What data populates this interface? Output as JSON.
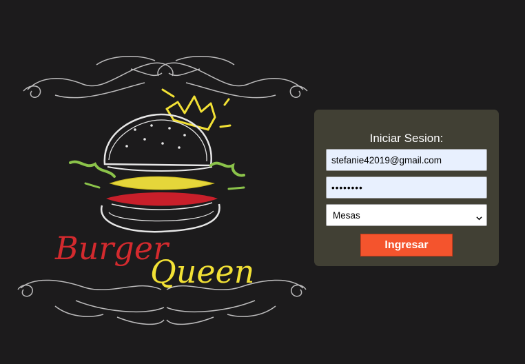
{
  "brand": {
    "word1": "Burger",
    "word2": "Queen"
  },
  "login": {
    "title": "Iniciar Sesion:",
    "email_value": "stefanie42019@gmail.com",
    "password_value": "••••••••",
    "role_selected": "Mesas",
    "submit_label": "Ingresar"
  },
  "colors": {
    "background": "#1c1b1c",
    "panel": "#414034",
    "button": "#f4542d",
    "brand_red": "#d32a2e",
    "brand_yellow": "#f2e135"
  },
  "icons": {
    "crown": "crown-icon",
    "burger": "burger-icon",
    "select_arrow": "chevron-down-icon"
  }
}
